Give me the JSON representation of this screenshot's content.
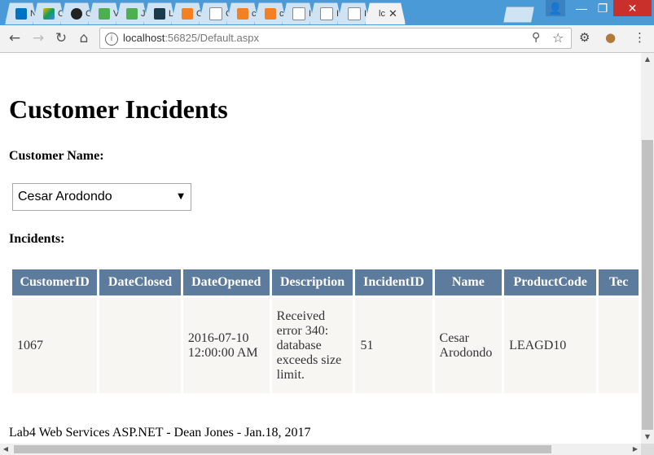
{
  "browser": {
    "tabs": [
      {
        "label": "N",
        "icon": "outlook-icon",
        "color": "#0072c6"
      },
      {
        "label": "C",
        "icon": "google-drive-icon",
        "color": "#f4b400"
      },
      {
        "label": "C",
        "icon": "github-icon",
        "color": "#222222"
      },
      {
        "label": "V",
        "icon": "w3schools-icon",
        "color": "#4caf50"
      },
      {
        "label": "J",
        "icon": "w3schools-icon",
        "color": "#4caf50"
      },
      {
        "label": "L",
        "icon": "m-icon",
        "color": "#1b3a4b"
      },
      {
        "label": "C",
        "icon": "stackoverflow-icon",
        "color": "#f48024"
      },
      {
        "label": "C",
        "icon": "document-icon",
        "color": "#ffffff"
      },
      {
        "label": "c",
        "icon": "stackoverflow-icon",
        "color": "#f48024"
      },
      {
        "label": "c",
        "icon": "stackoverflow-icon",
        "color": "#f48024"
      },
      {
        "label": "I",
        "icon": "document-icon",
        "color": "#ffffff"
      },
      {
        "label": "I",
        "icon": "document-icon",
        "color": "#ffffff"
      },
      {
        "label": "I",
        "icon": "document-icon",
        "color": "#ffffff"
      },
      {
        "label": "lc",
        "icon": "",
        "color": "#f2f2f2",
        "active": true
      }
    ],
    "active_tab_close": "✕",
    "url_host": "localhost",
    "url_path": ":56825/Default.aspx"
  },
  "page": {
    "title": "Customer Incidents",
    "customer_name_label": "Customer Name:",
    "customer_select_value": "Cesar Arodondo",
    "incidents_label": "Incidents:",
    "table": {
      "columns": [
        "CustomerID",
        "DateClosed",
        "DateOpened",
        "Description",
        "IncidentID",
        "Name",
        "ProductCode",
        "Tec"
      ],
      "rows": [
        [
          "1067",
          "",
          "2016-07-10 12:00:00 AM",
          "Received error 340: database exceeds size limit.",
          "51",
          "Cesar Arodondo",
          "LEAGD10",
          ""
        ]
      ]
    },
    "footer": "Lab4 Web Services ASP.NET - Dean Jones - Jan.18, 2017"
  },
  "colors": {
    "header_bg": "#5d7b9d",
    "header_text": "#ffffff",
    "cell_bg": "#f7f6f3",
    "titlebar": "#4a9ad8"
  }
}
